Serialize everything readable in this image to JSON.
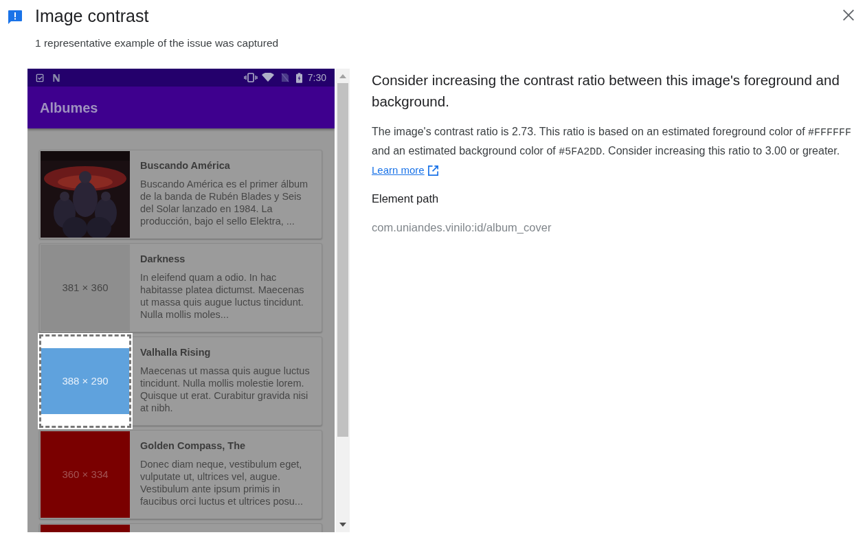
{
  "header": {
    "title": "Image contrast",
    "subtitle": "1 representative example of the issue was captured"
  },
  "screenshot": {
    "status_time": "7:30",
    "app_title": "Albumes",
    "cards": [
      {
        "kind": "picture",
        "highlighted": false,
        "title": "Buscando América",
        "description": "Buscando América es el primer álbum de la banda de Rubén Blades y Seis del Solar lanzado en 1984. La producción, bajo el sello Elektra, ..."
      },
      {
        "kind": "placeholder",
        "color": "#8e8e8e",
        "label": "381 × 360",
        "highlighted": false,
        "title": "Darkness",
        "description": "In eleifend quam a odio. In hac habitasse platea dictumst. Maecenas ut massa quis augue luctus tincidunt. Nulla mollis moles..."
      },
      {
        "kind": "placeholder",
        "color": "#5fa2dd",
        "label": "388 × 290",
        "highlighted": true,
        "title": "Valhalla Rising",
        "description": "Maecenas ut massa quis augue luctus tincidunt. Nulla mollis molestie lorem. Quisque ut erat. Curabitur gravida nisi at nibh."
      },
      {
        "kind": "placeholder",
        "color": "#7a0000",
        "label": "360 × 334",
        "highlighted": false,
        "title": "Golden Compass, The",
        "description": "Donec diam neque, vestibulum eget, vulputate ut, ultrices vel, augue. Vestibulum ante ipsum primis in faucibus orci luctus et ultrices posu..."
      },
      {
        "kind": "placeholder",
        "color": "#7a0000",
        "highlighted": false
      }
    ]
  },
  "details": {
    "heading": "Consider increasing the contrast ratio between this image's foreground and background.",
    "description": [
      {
        "kind": "text",
        "text": "The image's contrast ratio is 2.73. This ratio is based on an estimated foreground color of "
      },
      {
        "kind": "code",
        "text": "#FFFFFF"
      },
      {
        "kind": "text",
        "text": " and an estimated background color of "
      },
      {
        "kind": "code",
        "text": "#5FA2DD"
      },
      {
        "kind": "text",
        "text": ". Consider increasing this ratio to 3.00 or greater."
      }
    ],
    "link": "Learn more",
    "path_label": "Element path",
    "path": "com.uniandes.vinilo:id/album_cover"
  }
}
